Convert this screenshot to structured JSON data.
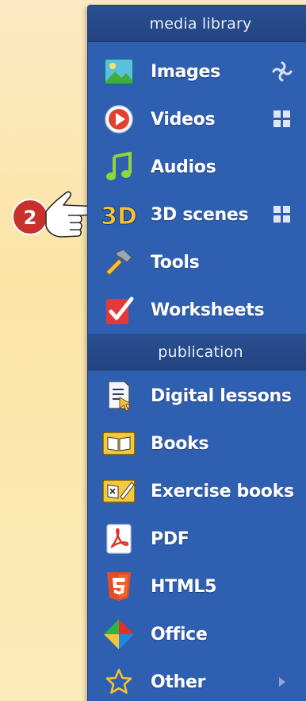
{
  "sections": {
    "media_library": "media library",
    "publication": "publication"
  },
  "items": {
    "images": "Images",
    "videos": "Videos",
    "audios": "Audios",
    "scenes3d": "3D scenes",
    "tools": "Tools",
    "worksheets": "Worksheets",
    "digital_lessons": "Digital lessons",
    "books": "Books",
    "exercise_books": "Exercise books",
    "pdf": "PDF",
    "html5": "HTML5",
    "office": "Office",
    "other": "Other"
  },
  "callout": {
    "number": "2"
  },
  "icons": {
    "images": "image-icon",
    "videos": "play-icon",
    "audios": "music-note-icon",
    "scenes3d": "3d-icon",
    "tools": "hammer-icon",
    "worksheets": "worksheet-check-icon",
    "digital_lessons": "lesson-icon",
    "books": "book-icon",
    "exercise_books": "exercise-book-icon",
    "pdf": "pdf-icon",
    "html5": "html5-icon",
    "office": "office-icon",
    "other": "star-icon",
    "loading": "spinner-icon",
    "grid": "grid-icon",
    "submenu": "arrow-right-icon"
  },
  "colors": {
    "panel": "#2f5fb0",
    "header": "#234381",
    "callout": "#c8302e",
    "background": "#fbe4a6"
  }
}
